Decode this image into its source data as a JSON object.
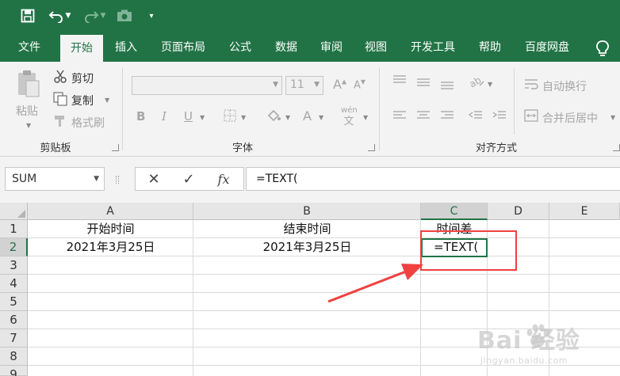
{
  "quick_access": {
    "save_icon": "save-icon",
    "undo_icon": "undo-icon",
    "redo_icon": "redo-icon",
    "camera_icon": "camera-icon",
    "customize_icon": "customize-qat-icon"
  },
  "tabs": [
    {
      "label": "文件",
      "active": false
    },
    {
      "label": "开始",
      "active": true
    },
    {
      "label": "插入",
      "active": false
    },
    {
      "label": "页面布局",
      "active": false
    },
    {
      "label": "公式",
      "active": false
    },
    {
      "label": "数据",
      "active": false
    },
    {
      "label": "审阅",
      "active": false
    },
    {
      "label": "视图",
      "active": false
    },
    {
      "label": "开发工具",
      "active": false
    },
    {
      "label": "帮助",
      "active": false
    },
    {
      "label": "百度网盘",
      "active": false
    }
  ],
  "ribbon": {
    "clipboard": {
      "paste_label": "粘贴",
      "cut_label": "剪切",
      "copy_label": "复制",
      "format_painter_label": "格式刷",
      "group_label": "剪贴板"
    },
    "font": {
      "font_size_value": "11",
      "grow_label": "A",
      "shrink_label": "A",
      "bold_label": "B",
      "italic_label": "I",
      "underline_label": "U",
      "font_color_label": "A",
      "phonetic_label": "wén",
      "group_label": "字体"
    },
    "alignment": {
      "wrap_text_label": "自动换行",
      "merge_center_label": "合并后居中",
      "group_label": "对齐方式"
    }
  },
  "formula_bar": {
    "name_box": "SUM",
    "cancel_symbol": "✕",
    "enter_symbol": "✓",
    "fx_symbol": "fx",
    "content": "=TEXT("
  },
  "grid": {
    "columns": [
      "A",
      "B",
      "C",
      "D",
      "E"
    ],
    "rows": [
      "1",
      "2",
      "3",
      "4",
      "5",
      "6",
      "7",
      "8",
      "9"
    ],
    "cells": {
      "A1": "开始时间",
      "B1": "结束时间",
      "C1": "时间差",
      "A2": "2021年3月25日",
      "B2": "2021年3月25日",
      "C2": "=TEXT("
    },
    "active_cell": "C2"
  },
  "annotation": {
    "highlight_color": "#f04040"
  },
  "watermark": {
    "main": "Bai  经验",
    "sub": "jingyan.baidu.com"
  },
  "colors": {
    "excel_green": "#217346",
    "ribbon_bg": "#f3f3f3"
  }
}
